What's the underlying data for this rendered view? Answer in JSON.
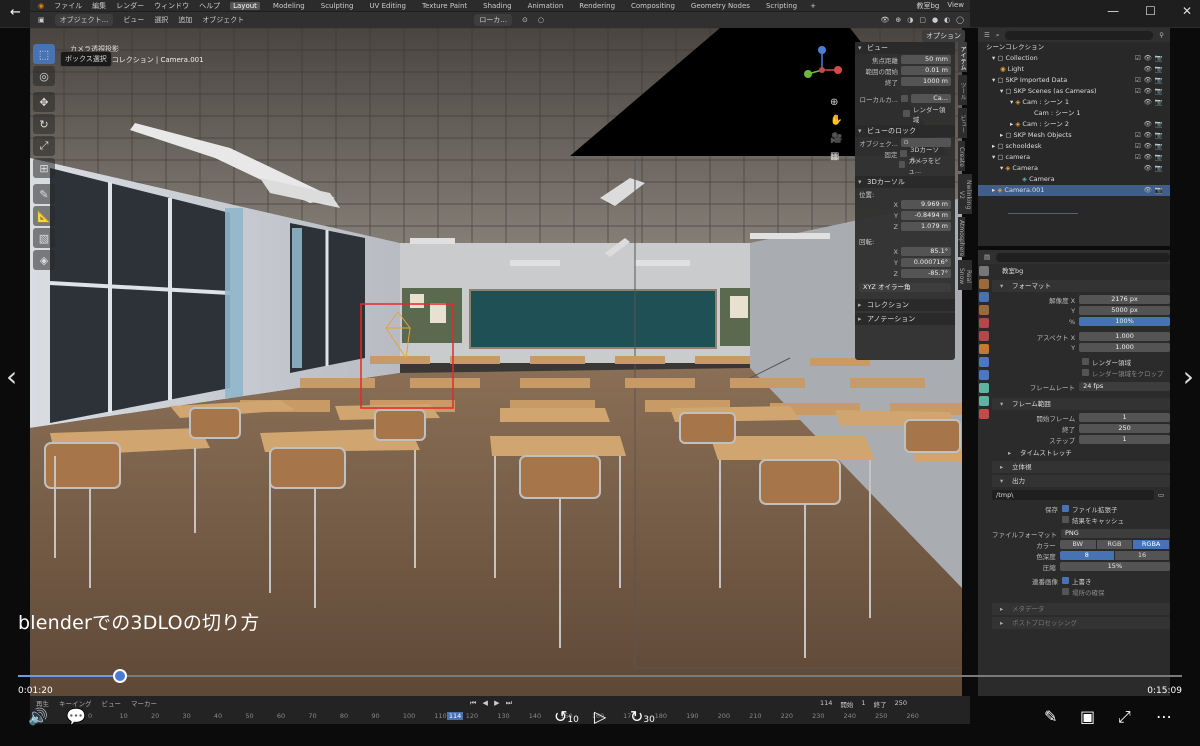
{
  "blender": {
    "menus": [
      "ファイル",
      "編集",
      "レンダー",
      "ウィンドウ",
      "ヘルプ"
    ],
    "workspaces": [
      "Layout",
      "Modeling",
      "Sculpting",
      "UV Editing",
      "Texture Paint",
      "Shading",
      "Animation",
      "Rendering",
      "Compositing",
      "Geometry Nodes",
      "Scripting"
    ],
    "active_workspace": "Layout",
    "scene_name": "教室bg",
    "view_layer": "View",
    "header2": {
      "mode": "オブジェクト...",
      "view": "ビュー",
      "select": "選択",
      "add": "追加",
      "object": "オブジェクト",
      "transform": "ローカ...",
      "options": "オプション"
    },
    "tooltip": "ボックス選択",
    "viewport_info": {
      "line1": "カメラ透視投影",
      "line2": "(114) シーンコレクション | Camera.001"
    },
    "n_panel": {
      "view_header": "ビュー",
      "focal_label": "焦点距離",
      "focal_value": "50 mm",
      "clip_start_label": "範囲の開始",
      "clip_start_value": "0.01 m",
      "clip_end_label": "終了",
      "clip_end_value": "1000 m",
      "local_camera_label": "ローカルカ...",
      "local_camera_value": "Ca...",
      "render_region_label": "レンダー領域",
      "view_lock_header": "ビューのロック",
      "lock_object_label": "オブジェク...",
      "lock_label": "固定",
      "lock_3dcursor": "3Dカーソル...",
      "camera_to_view": "カメラをビュ...",
      "cursor_header": "3Dカーソル",
      "location_label": "位置:",
      "cx": "9.969 m",
      "cy": "-0.8494 m",
      "cz": "1.079 m",
      "rotation_label": "回転:",
      "rx": "85.1°",
      "ry": "0.000716°",
      "rz": "-85.7°",
      "rot_mode": "XYZ オイラー角",
      "collection_header": "コレクション",
      "annotation_header": "アノテーション"
    },
    "n_tabs": [
      "アイテム",
      "ツール",
      "ビュー",
      "Create",
      "Nwlinking V2",
      "Atmosphere",
      "Real Snow"
    ],
    "outliner": {
      "root": "シーンコレクション",
      "rows": [
        {
          "label": "Collection",
          "indent": 1
        },
        {
          "label": "Light",
          "indent": 2
        },
        {
          "label": "SKP Imported Data",
          "indent": 1
        },
        {
          "label": "SKP Scenes (as Cameras)",
          "indent": 2
        },
        {
          "label": "Cam : シーン 1",
          "indent": 3
        },
        {
          "label": "Cam : シーン 1",
          "indent": 4
        },
        {
          "label": "Cam : シーン 2",
          "indent": 3
        },
        {
          "label": "SKP Mesh Objects",
          "indent": 2
        },
        {
          "label": "schooldesk",
          "indent": 1
        },
        {
          "label": "camera",
          "indent": 1
        },
        {
          "label": "Camera",
          "indent": 2
        },
        {
          "label": "Camera",
          "indent": 3
        },
        {
          "label": "Camera.001",
          "indent": 1
        }
      ]
    },
    "properties": {
      "scene": "教室bg",
      "format_header": "フォーマット",
      "res_label": "解像度 X",
      "res_x": "2176 px",
      "y_label": "Y",
      "res_y": "5000 px",
      "pct_label": "%",
      "res_pct": "100%",
      "aspect_label": "アスペクト X",
      "aspect_x": "1.000",
      "aspect_y": "1.000",
      "render_region": "レンダー領域",
      "crop_region": "レンダー領域をクロップ",
      "fps_label": "フレームレート",
      "fps": "24 fps",
      "frame_range_header": "フレーム範囲",
      "start_label": "開始フレーム",
      "start": "1",
      "end_label": "終了",
      "end": "250",
      "step_label": "ステップ",
      "step": "1",
      "time_stretch": "タイムストレッチ",
      "stereo": "立体視",
      "output_header": "出力",
      "output_path": "/tmp\\",
      "save_label": "保存",
      "file_ext": "ファイル拡張子",
      "cache_result": "結果をキャッシュ",
      "file_format_label": "ファイルフォーマット",
      "file_format": "PNG",
      "color_label": "カラー",
      "color_modes": [
        "BW",
        "RGB",
        "RGBA"
      ],
      "color_active": "RGBA",
      "depth_label": "色深度",
      "depth_modes": [
        "8",
        "16"
      ],
      "depth_active": "8",
      "compression_label": "圧縮",
      "compression": "15%",
      "image_seq_label": "連番画像",
      "overwrite": "上書き",
      "placeholders": "場所の確保",
      "metadata_header": "メタデータ",
      "postprocess_header": "ポストプロセッシング"
    },
    "timeline": {
      "menus": [
        "再生",
        "キーイング",
        "ビュー",
        "マーカー"
      ],
      "ticks": [
        "0",
        "10",
        "20",
        "30",
        "40",
        "50",
        "60",
        "70",
        "80",
        "90",
        "100",
        "110",
        "120",
        "130",
        "140",
        "150",
        "160",
        "170",
        "180",
        "190",
        "200",
        "210",
        "220",
        "230",
        "240",
        "250",
        "260"
      ],
      "current": "114",
      "start_label": "開始",
      "start": "1",
      "end_label": "終了",
      "end": "250"
    }
  },
  "video": {
    "subtitle": "blenderでの3DLOの切り方",
    "current_time": "0:01:20",
    "total_time": "0:15:09",
    "progress": 0.088,
    "skip_back": "10",
    "skip_fwd": "30"
  },
  "colors": {
    "accent": "#4772b3",
    "progress": "#6b9be8",
    "selection_box": "#e8262a"
  }
}
